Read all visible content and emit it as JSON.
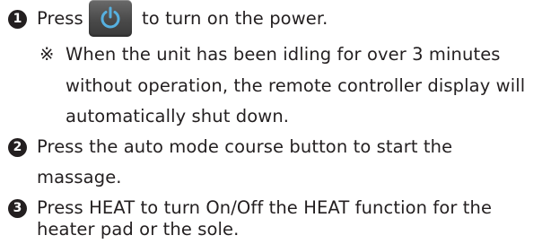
{
  "steps": [
    {
      "number": "1",
      "before_icon": "Press",
      "icon": "power-icon",
      "after_icon": "to turn on the power.",
      "note_mark": "※",
      "note_lines": [
        "When the unit has been idling for over 3 minutes",
        "without operation, the remote controller display will",
        "automatically shut down."
      ]
    },
    {
      "number": "2",
      "lines": [
        "Press the auto mode course button to start the",
        "massage."
      ]
    },
    {
      "number": "3",
      "lines": [
        "Press HEAT to turn On/Off the HEAT function for the",
        "heater pad or the sole."
      ]
    }
  ],
  "colors": {
    "text": "#231f20",
    "icon_button": "#4a4a4a",
    "icon_symbol": "#56b0e0"
  }
}
